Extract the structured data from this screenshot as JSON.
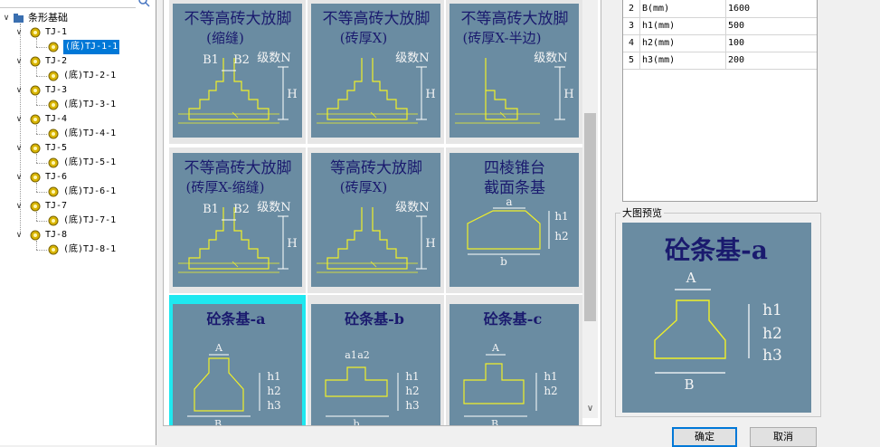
{
  "tree": {
    "root_label": "条形基础",
    "nodes": [
      {
        "label": "TJ-1",
        "child": "(底)TJ-1-1"
      },
      {
        "label": "TJ-2",
        "child": "(底)TJ-2-1"
      },
      {
        "label": "TJ-3",
        "child": "(底)TJ-3-1"
      },
      {
        "label": "TJ-4",
        "child": "(底)TJ-4-1"
      },
      {
        "label": "TJ-5",
        "child": "(底)TJ-5-1"
      },
      {
        "label": "TJ-6",
        "child": "(底)TJ-6-1"
      },
      {
        "label": "TJ-7",
        "child": "(底)TJ-7-1"
      },
      {
        "label": "TJ-8",
        "child": "(底)TJ-8-1"
      }
    ],
    "selected": "(底)TJ-1-1"
  },
  "tiles": [
    {
      "title1": "不等高砖大放脚",
      "title2": "(缩缝)",
      "type": "brick",
      "dims": [
        "B1",
        "B2",
        "级数N",
        "H"
      ]
    },
    {
      "title1": "不等高砖大放脚",
      "title2": "(砖厚X)",
      "type": "brick",
      "dims": [
        "级数N",
        "H"
      ]
    },
    {
      "title1": "不等高砖大放脚",
      "title2": "(砖厚X-半边)",
      "type": "brick-half",
      "dims": [
        "级数N",
        "H"
      ]
    },
    {
      "title1": "不等高砖大放脚",
      "title2": "(砖厚X-缩缝)",
      "type": "brick",
      "dims": [
        "B1",
        "B2",
        "级数N",
        "H"
      ]
    },
    {
      "title1": "等高砖大放脚",
      "title2": "(砖厚X)",
      "type": "brick",
      "dims": [
        "级数N",
        "H"
      ]
    },
    {
      "title1": "四棱锥台",
      "title2": "截面条基",
      "type": "frustum",
      "dims": [
        "a",
        "b",
        "h1",
        "h2"
      ]
    },
    {
      "title1": "砼条基-a",
      "title2": "",
      "type": "conc-a",
      "dims": [
        "A",
        "B",
        "h1",
        "h2",
        "h3"
      ]
    },
    {
      "title1": "砼条基-b",
      "title2": "",
      "type": "conc-b",
      "dims": [
        "a1",
        "a2",
        "b",
        "h1",
        "h2",
        "h3"
      ]
    },
    {
      "title1": "砼条基-c",
      "title2": "",
      "type": "conc-c",
      "dims": [
        "A",
        "B",
        "h1",
        "h2"
      ]
    }
  ],
  "params": [
    {
      "no": "2",
      "name": "B(mm)",
      "value": "1600"
    },
    {
      "no": "3",
      "name": "h1(mm)",
      "value": "500"
    },
    {
      "no": "4",
      "name": "h2(mm)",
      "value": "100"
    },
    {
      "no": "5",
      "name": "h3(mm)",
      "value": "200"
    }
  ],
  "preview": {
    "group_title": "大图预览",
    "title": "砼条基-a",
    "dims": [
      "A",
      "B",
      "h1",
      "h2",
      "h3"
    ]
  },
  "buttons": {
    "ok": "确定",
    "cancel": "取消"
  },
  "colors": {
    "tile_bg": "#6a8ca2",
    "line": "#f0f028",
    "title": "#1a1a6e",
    "selected": "#1ee8f0"
  }
}
